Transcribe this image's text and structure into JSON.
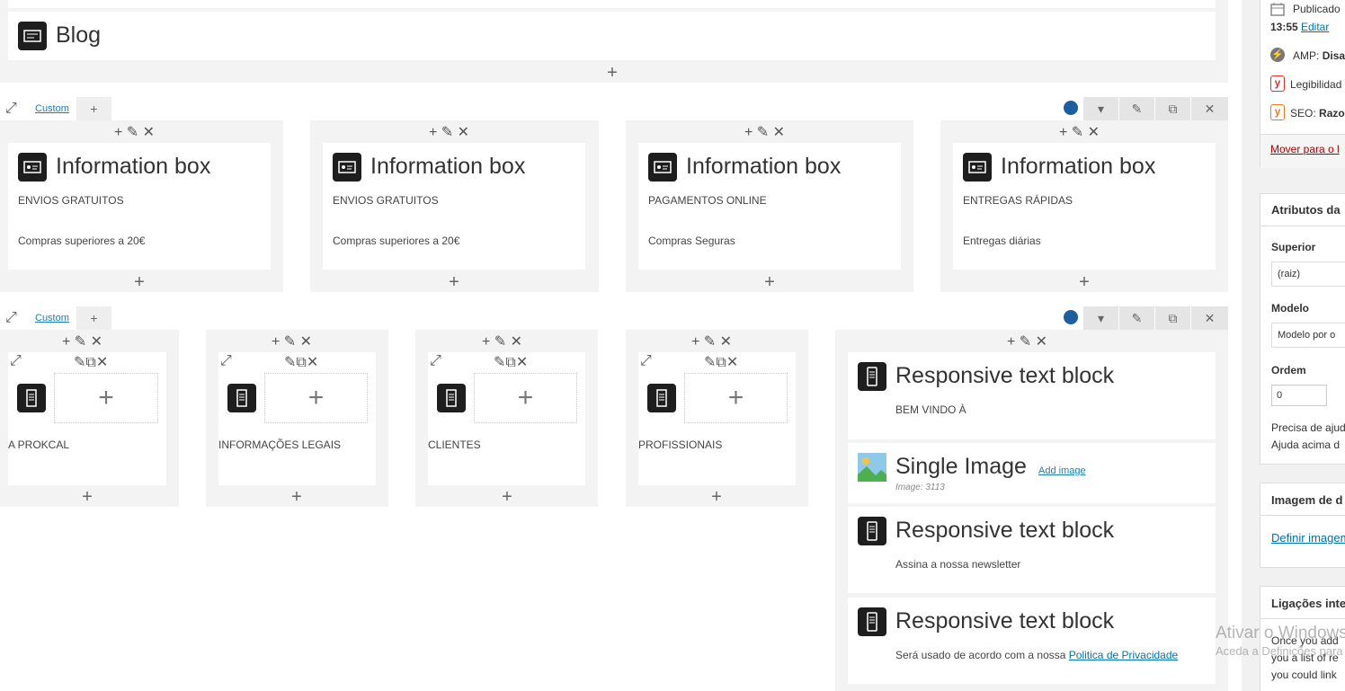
{
  "blog": {
    "title": "Blog"
  },
  "rows": {
    "row1": {
      "tab_label": "Custom"
    },
    "row2": {
      "tab_label": "Custom"
    }
  },
  "info_boxes": [
    {
      "title": "Information box",
      "line1": "ENVIOS GRATUITOS",
      "line2": "Compras superiores a 20€"
    },
    {
      "title": "Information box",
      "line1": "ENVIOS GRATUITOS",
      "line2": "Compras superiores a 20€"
    },
    {
      "title": "Information box",
      "line1": "PAGAMENTOS ONLINE",
      "line2": "Compras Seguras"
    },
    {
      "title": "Information box",
      "line1": "ENTREGAS RÁPIDAS",
      "line2": "Entregas diárias"
    }
  ],
  "footer_columns": [
    {
      "label": "A PROKCAL"
    },
    {
      "label": "INFORMAÇÕES LEGAIS"
    },
    {
      "label": "CLIENTES"
    },
    {
      "label": "PROFISSIONAIS"
    }
  ],
  "right_column": {
    "block1": {
      "title": "Responsive text block",
      "text": "BEM VINDO À"
    },
    "image": {
      "title": "Single Image",
      "add_label": "Add image",
      "caption": "Image: 3113"
    },
    "block2": {
      "title": "Responsive text block",
      "text": "Assina a nossa newsletter"
    },
    "block3": {
      "title": "Responsive text block",
      "text": "Será usado de acordo com a nossa",
      "link": "Politica de Privacidade"
    }
  },
  "sidebar": {
    "published_label": "Publicado",
    "published_time": "13:55",
    "edit_link": "Editar",
    "amp_label": "AMP:",
    "amp_value": "Disa",
    "readability_label": "Legibilidad",
    "seo_label": "SEO:",
    "seo_value": "Razoa",
    "trash_link": "Mover para o l",
    "attributes_title": "Atributos da",
    "parent_label": "Superior",
    "parent_value": "(raiz)",
    "template_label": "Modelo",
    "template_value": "Modelo por o",
    "order_label": "Ordem",
    "order_value": "0",
    "help_line1": "Precisa de ajud",
    "help_line2": "Ajuda acima d",
    "featured_title": "Imagem de d",
    "featured_link": "Definir imagem",
    "links_title": "Ligações inte",
    "links_line1": "Once you add",
    "links_line2": "you a list of re",
    "links_line3": "you could link"
  },
  "watermark": {
    "line1": "Ativar o Windows",
    "line2": "Aceda a Definições para ativar o Windows."
  },
  "colors": {
    "accent_dot": "#1d5e9e",
    "link": "#0073aa",
    "yoast_red": "#dc3232",
    "yoast_orange": "#ee7c1b"
  }
}
